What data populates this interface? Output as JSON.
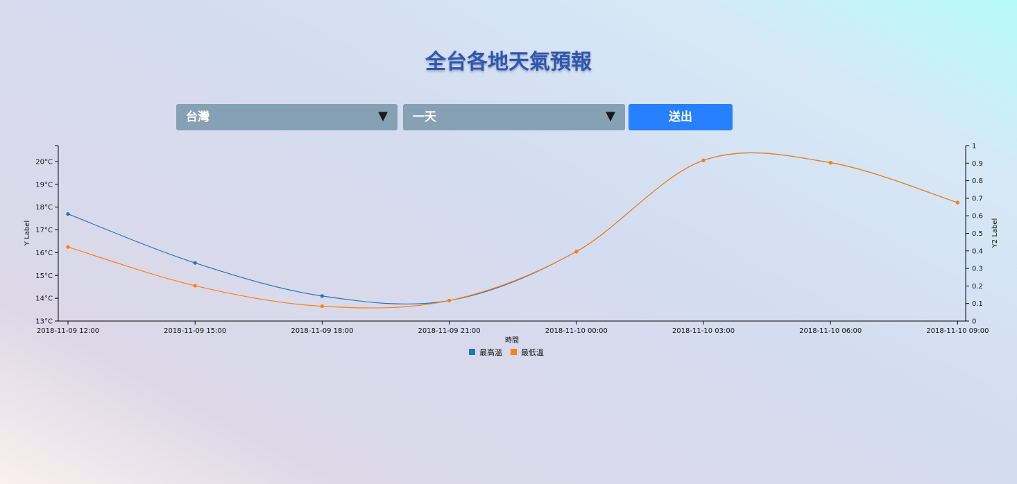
{
  "page": {
    "title": "全台各地天氣預報"
  },
  "controls": {
    "region": {
      "value": "台灣"
    },
    "period": {
      "value": "一天"
    },
    "submit_label": "送出",
    "caret": "▼"
  },
  "chart_data": {
    "type": "line",
    "xlabel": "時間",
    "ylabel": "Y Label",
    "y2label": "Y2 Label",
    "categories": [
      "2018-11-09 12:00",
      "2018-11-09 15:00",
      "2018-11-09 18:00",
      "2018-11-09 21:00",
      "2018-11-10 00:00",
      "2018-11-10 03:00",
      "2018-11-10 06:00",
      "2018-11-10 09:00"
    ],
    "yticks": [
      "13°C",
      "14°C",
      "15°C",
      "16°C",
      "17°C",
      "18°C",
      "19°C",
      "20°C"
    ],
    "ylim": [
      13,
      20.7
    ],
    "y2ticks": [
      "0",
      "0.1",
      "0.2",
      "0.3",
      "0.4",
      "0.5",
      "0.6",
      "0.7",
      "0.8",
      "0.9",
      "1"
    ],
    "y2lim": [
      0,
      1
    ],
    "legend_position": "bottom-center",
    "series": [
      {
        "name": "最高溫",
        "color": "#1f77b4",
        "values": [
          17.7,
          15.55,
          14.1,
          13.9,
          16.05,
          20.05,
          19.95,
          18.2
        ]
      },
      {
        "name": "最低溫",
        "color": "#ff7f0e",
        "values": [
          16.25,
          14.55,
          13.65,
          13.9,
          16.05,
          20.05,
          19.95,
          18.2
        ]
      }
    ]
  }
}
